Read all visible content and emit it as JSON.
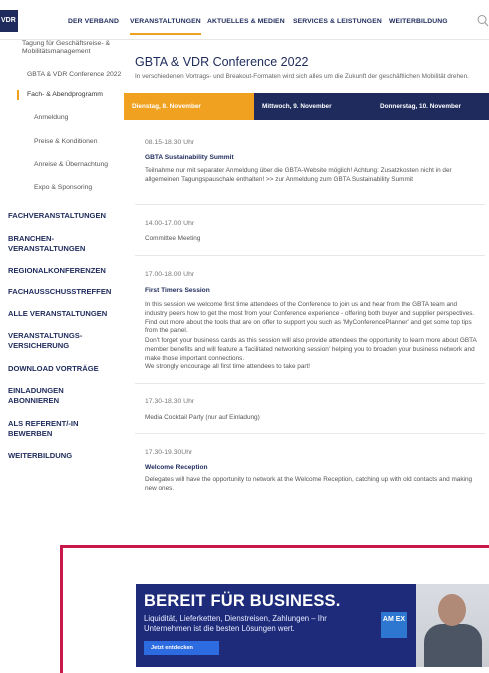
{
  "nav": {
    "logo": "VDR",
    "items": [
      "DER VERBAND",
      "VERANSTALTUNGEN",
      "AKTUELLES & MEDIEN",
      "SERVICES & LEISTUNGEN",
      "WEITERBILDUNG"
    ],
    "active": "VERANSTALTUNGEN"
  },
  "sidebar": {
    "sub": [
      "Tagung für Geschäftsreise- &",
      "Mobilitätsmanagement",
      "GBTA & VDR Conference 2022",
      "Fach- & Abendprogramm",
      "Anmeldung",
      "Preise & Konditionen",
      "Anreise & Übernachtung",
      "Expo & Sponsoring"
    ],
    "main": [
      "FACHVERANSTALTUNGEN",
      "BRANCHEN-",
      "VERANSTALTUNGEN",
      "REGIONALKONFERENZEN",
      "FACHAUSSCHUSSTREFFEN",
      "ALLE VERANSTALTUNGEN",
      "VERANSTALTUNGS-",
      "VERSICHERUNG",
      "DOWNLOAD VORTRÄGE",
      "EINLADUNGEN",
      "ABONNIEREN",
      "ALS REFERENT/-IN",
      "BEWERBEN",
      "WEITERBILDUNG"
    ]
  },
  "main": {
    "title": "GBTA & VDR Conference 2022",
    "intro": "In verschiedenen Vortrags- und Breakout-Formaten wird sich alles um die Zukunft der geschäftlichen Mobilität drehen.",
    "tabs": [
      "Dienstag, 8. November",
      "Mittwoch, 9. November",
      "Donnerstag, 10. November"
    ],
    "events": [
      {
        "time": "08.15-18.30 Uhr",
        "title": "GBTA Sustainability Summit",
        "text": "Teilnahme nur mit separater Anmeldung über die GBTA-Website möglich! Achtung: Zusatzkosten nicht in der allgemeinen Tagungspauschale enthalten! >> zur Anmeldung zum GBTA Sustainability Summit"
      },
      {
        "time": "14.00-17.00 Uhr",
        "title": "",
        "text": "Committee Meeting"
      },
      {
        "time": "17.00-18.00 Uhr",
        "title": "First Timers Session",
        "text": "In this session we welcome first time attendees of the Conference to join us and hear from the GBTA team and industry peers how to get the most from your Conference experience - offering both buyer and supplier perspectives. Find out more about the tools that are on offer to support you such as 'MyConferencePlanner' and get some top tips from the panel.",
        "text2": "Don't forget your business cards as this session will also provide attendees the opportunity to learn more about GBTA member benefits and will feature a 'facilitated networking session' helping you to broaden your business network and make those important connections.",
        "text3": "We strongly encourage all first time attendees to take part!"
      },
      {
        "time": "17.30-18.30 Uhr",
        "title": "",
        "text": "Media Cocktail Party (nur auf Einladung)"
      },
      {
        "time": "17.30-19.30Uhr",
        "title": "Welcome Reception",
        "text": "Delegates will have the opportunity to network at the Welcome Reception, catching up with old contacts and making new ones."
      }
    ]
  },
  "ad": {
    "headline": "BEREIT FÜR BUSINESS.",
    "subline": "Liquidität, Lieferketten, Dienstreisen, Zahlungen – Ihr Unternehmen ist die besten Lösungen wert.",
    "button": "Jetzt entdecken",
    "logo": "AM EX"
  },
  "colors": {
    "navy": "#1e2b5c",
    "orange": "#f0a11f",
    "adBlue": "#1e2b7a",
    "crimson": "#c8194a"
  }
}
